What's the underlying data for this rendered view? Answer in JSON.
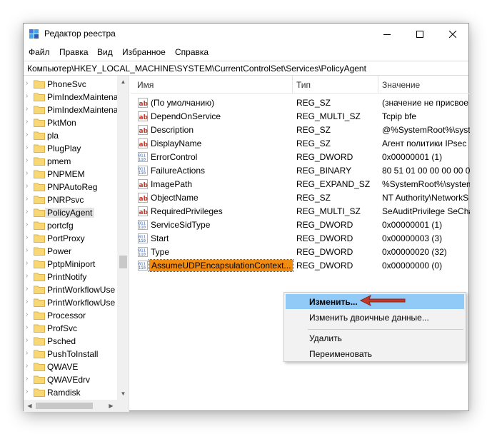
{
  "window": {
    "title": "Редактор реестра"
  },
  "menu": [
    "Файл",
    "Правка",
    "Вид",
    "Избранное",
    "Справка"
  ],
  "address": "Компьютер\\HKEY_LOCAL_MACHINE\\SYSTEM\\CurrentControlSet\\Services\\PolicyAgent",
  "tree": {
    "items": [
      "PhoneSvc",
      "PimIndexMaintena",
      "PimIndexMaintena",
      "PktMon",
      "pla",
      "PlugPlay",
      "pmem",
      "PNPMEM",
      "PNPAutoReg",
      "PNRPsvc",
      "PolicyAgent",
      "portcfg",
      "PortProxy",
      "Power",
      "PptpMiniport",
      "PrintNotify",
      "PrintWorkflowUse",
      "PrintWorkflowUse",
      "Processor",
      "ProfSvc",
      "Psched",
      "PushToInstall",
      "QWAVE",
      "QWAVEdrv",
      "Ramdisk"
    ],
    "selected": "PolicyAgent"
  },
  "columns": {
    "name": "Имя",
    "type": "Тип",
    "data": "Значение"
  },
  "values": [
    {
      "icon": "ab",
      "name": "(По умолчанию)",
      "type": "REG_SZ",
      "data": "(значение не присвое"
    },
    {
      "icon": "ab",
      "name": "DependOnService",
      "type": "REG_MULTI_SZ",
      "data": "Tcpip bfe"
    },
    {
      "icon": "ab",
      "name": "Description",
      "type": "REG_SZ",
      "data": "@%SystemRoot%\\syste"
    },
    {
      "icon": "ab",
      "name": "DisplayName",
      "type": "REG_SZ",
      "data": "Агент политики IPsec"
    },
    {
      "icon": "bin",
      "name": "ErrorControl",
      "type": "REG_DWORD",
      "data": "0x00000001 (1)"
    },
    {
      "icon": "bin",
      "name": "FailureActions",
      "type": "REG_BINARY",
      "data": "80 51 01 00 00 00 00 0"
    },
    {
      "icon": "ab",
      "name": "ImagePath",
      "type": "REG_EXPAND_SZ",
      "data": "%SystemRoot%\\system"
    },
    {
      "icon": "ab",
      "name": "ObjectName",
      "type": "REG_SZ",
      "data": "NT Authority\\NetworkS"
    },
    {
      "icon": "ab",
      "name": "RequiredPrivileges",
      "type": "REG_MULTI_SZ",
      "data": "SeAuditPrivilege SeCha"
    },
    {
      "icon": "bin",
      "name": "ServiceSidType",
      "type": "REG_DWORD",
      "data": "0x00000001 (1)"
    },
    {
      "icon": "bin",
      "name": "Start",
      "type": "REG_DWORD",
      "data": "0x00000003 (3)"
    },
    {
      "icon": "bin",
      "name": "Type",
      "type": "REG_DWORD",
      "data": "0x00000020 (32)"
    },
    {
      "icon": "bin",
      "name": "AssumeUDPEncapsulationContext...",
      "type": "REG_DWORD",
      "data": "0x00000000 (0)"
    }
  ],
  "context_menu": {
    "modify": "Изменить...",
    "modify_binary": "Изменить двоичные данные...",
    "delete": "Удалить",
    "rename": "Переименовать"
  },
  "colors": {
    "selection": "#f28c11",
    "menu_highlight": "#91c9f7",
    "arrow": "#c0392b",
    "folder": "#f8d775"
  }
}
